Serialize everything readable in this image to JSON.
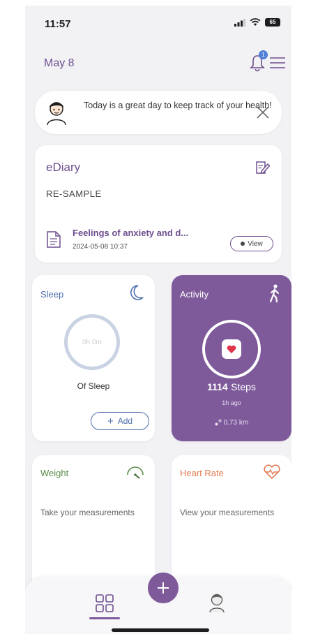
{
  "status_bar": {
    "time": "11:57",
    "battery": "65"
  },
  "header": {
    "date": "May 8",
    "notification_count": "1"
  },
  "greeting": {
    "message": "Today is a great day to keep track of your health!"
  },
  "ediary": {
    "title": "eDiary",
    "subtitle": "RE-SAMPLE",
    "entry_title": "Feelings of anxiety and d...",
    "entry_date": "2024-05-08 10:37",
    "view_label": "View"
  },
  "sleep": {
    "title": "Sleep",
    "ring_value": "0h 0m",
    "label": "Of Sleep",
    "add_label": "Add"
  },
  "activity": {
    "title": "Activity",
    "steps_value": "1114",
    "steps_unit": "Steps",
    "time_ago": "1h ago",
    "distance": "0.73 km"
  },
  "weight": {
    "title": "Weight",
    "body": "Take your measurements"
  },
  "heart_rate": {
    "title": "Heart Rate",
    "body": "View your measurements"
  },
  "colors": {
    "accent": "#7e5a9b",
    "title_purple": "#6e4f8f",
    "sleep_blue": "#4f6fae",
    "weight_green": "#5a8c4a",
    "heart_orange": "#e07a50"
  },
  "icons": {
    "bell": "bell-icon",
    "menu": "hamburger-menu-icon",
    "close": "close-icon",
    "edit": "edit-note-icon",
    "document": "document-icon",
    "moon": "moon-icon",
    "walk": "walking-person-icon",
    "scale": "scale-gauge-icon",
    "heart_pulse": "heart-pulse-icon",
    "home": "grid-home-icon",
    "plus": "plus-icon",
    "profile": "profile-icon"
  }
}
